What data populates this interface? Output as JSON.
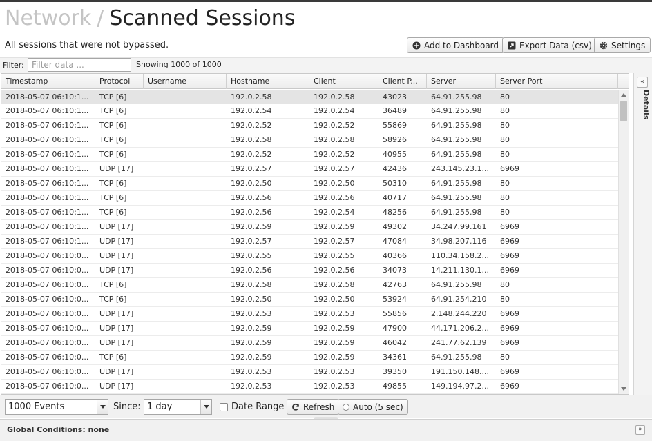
{
  "header": {
    "breadcrumb_parent": "Network",
    "breadcrumb_sep": "/",
    "title": "Scanned Sessions",
    "subtitle": "All sessions that were not bypassed.",
    "add_dashboard_label": "Add to Dashboard",
    "export_label": "Export Data (csv)",
    "settings_label": "Settings"
  },
  "filter": {
    "label": "Filter:",
    "placeholder": "Filter data ...",
    "count_text": "Showing 1000 of 1000"
  },
  "table": {
    "columns": [
      "Timestamp",
      "Protocol",
      "Username",
      "Hostname",
      "Client",
      "Client P...",
      "Server",
      "Server Port"
    ],
    "rows": [
      [
        "2018-05-07 06:10:1...",
        "TCP [6]",
        "",
        "192.0.2.58",
        "192.0.2.58",
        "43023",
        "64.91.255.98",
        "80"
      ],
      [
        "2018-05-07 06:10:1...",
        "TCP [6]",
        "",
        "192.0.2.54",
        "192.0.2.54",
        "36489",
        "64.91.255.98",
        "80"
      ],
      [
        "2018-05-07 06:10:1...",
        "TCP [6]",
        "",
        "192.0.2.52",
        "192.0.2.52",
        "55869",
        "64.91.255.98",
        "80"
      ],
      [
        "2018-05-07 06:10:1...",
        "TCP [6]",
        "",
        "192.0.2.58",
        "192.0.2.58",
        "58926",
        "64.91.255.98",
        "80"
      ],
      [
        "2018-05-07 06:10:1...",
        "TCP [6]",
        "",
        "192.0.2.52",
        "192.0.2.52",
        "40955",
        "64.91.255.98",
        "80"
      ],
      [
        "2018-05-07 06:10:1...",
        "UDP [17]",
        "",
        "192.0.2.57",
        "192.0.2.57",
        "42436",
        "243.145.23.1...",
        "6969"
      ],
      [
        "2018-05-07 06:10:1...",
        "TCP [6]",
        "",
        "192.0.2.50",
        "192.0.2.50",
        "50310",
        "64.91.255.98",
        "80"
      ],
      [
        "2018-05-07 06:10:1...",
        "TCP [6]",
        "",
        "192.0.2.56",
        "192.0.2.56",
        "40717",
        "64.91.255.98",
        "80"
      ],
      [
        "2018-05-07 06:10:1...",
        "TCP [6]",
        "",
        "192.0.2.56",
        "192.0.2.54",
        "48256",
        "64.91.255.98",
        "80"
      ],
      [
        "2018-05-07 06:10:1...",
        "UDP [17]",
        "",
        "192.0.2.59",
        "192.0.2.59",
        "49302",
        "34.247.99.161",
        "6969"
      ],
      [
        "2018-05-07 06:10:1...",
        "UDP [17]",
        "",
        "192.0.2.57",
        "192.0.2.57",
        "47084",
        "34.98.207.116",
        "6969"
      ],
      [
        "2018-05-07 06:10:0...",
        "UDP [17]",
        "",
        "192.0.2.55",
        "192.0.2.55",
        "40366",
        "110.34.158.2...",
        "6969"
      ],
      [
        "2018-05-07 06:10:0...",
        "UDP [17]",
        "",
        "192.0.2.56",
        "192.0.2.56",
        "34073",
        "14.211.130.1...",
        "6969"
      ],
      [
        "2018-05-07 06:10:0...",
        "TCP [6]",
        "",
        "192.0.2.58",
        "192.0.2.58",
        "42763",
        "64.91.255.98",
        "80"
      ],
      [
        "2018-05-07 06:10:0...",
        "TCP [6]",
        "",
        "192.0.2.50",
        "192.0.2.50",
        "53924",
        "64.91.254.210",
        "80"
      ],
      [
        "2018-05-07 06:10:0...",
        "UDP [17]",
        "",
        "192.0.2.53",
        "192.0.2.53",
        "55856",
        "2.148.244.220",
        "6969"
      ],
      [
        "2018-05-07 06:10:0...",
        "UDP [17]",
        "",
        "192.0.2.59",
        "192.0.2.59",
        "47900",
        "44.171.206.2...",
        "6969"
      ],
      [
        "2018-05-07 06:10:0...",
        "UDP [17]",
        "",
        "192.0.2.59",
        "192.0.2.59",
        "46042",
        "241.77.62.139",
        "6969"
      ],
      [
        "2018-05-07 06:10:0...",
        "TCP [6]",
        "",
        "192.0.2.59",
        "192.0.2.59",
        "34361",
        "64.91.255.98",
        "80"
      ],
      [
        "2018-05-07 06:10:0...",
        "UDP [17]",
        "",
        "192.0.2.53",
        "192.0.2.53",
        "39350",
        "191.150.148....",
        "6969"
      ],
      [
        "2018-05-07 06:10:0...",
        "UDP [17]",
        "",
        "192.0.2.53",
        "192.0.2.53",
        "49855",
        "149.194.97.2...",
        "6969"
      ]
    ]
  },
  "details": {
    "label": "Details",
    "collapse_glyph": "«"
  },
  "bottom": {
    "events_value": "1000 Events",
    "since_label": "Since:",
    "since_value": "1 day",
    "date_range_label": "Date Range",
    "refresh_label": "Refresh",
    "auto_label": "Auto (5 sec)"
  },
  "global": {
    "label": "Global Conditions: none",
    "expand_glyph": "»"
  },
  "colors": {
    "selected_row": "#e4e4e4",
    "breadcrumb": "#c4c4c4"
  }
}
